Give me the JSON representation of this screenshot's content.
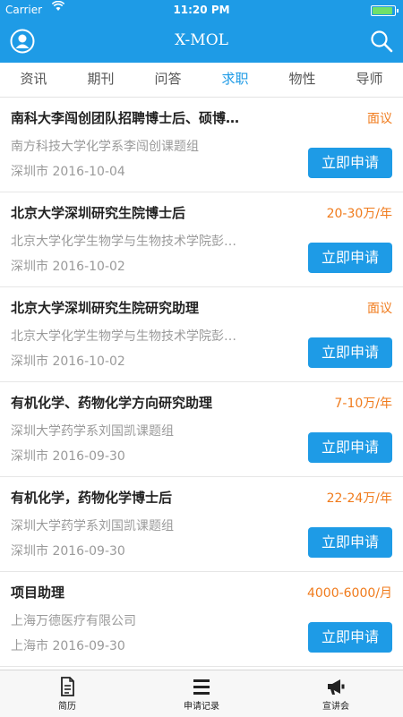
{
  "status_bar": {
    "carrier": "Carrier",
    "time": "11:20 PM"
  },
  "nav": {
    "title": "X-MOL",
    "profile_icon": "person-circle-icon",
    "search_icon": "search-icon"
  },
  "tabs": [
    {
      "label": "资讯"
    },
    {
      "label": "期刊"
    },
    {
      "label": "问答"
    },
    {
      "label": "求职",
      "active": true
    },
    {
      "label": "物性"
    },
    {
      "label": "导师"
    }
  ],
  "apply_label": "立即申请",
  "jobs": [
    {
      "title": "南科大李闯创团队招聘博士后、硕博…",
      "salary": "面议",
      "org": "南方科技大学化学系李闯创课题组",
      "meta": "深圳市 2016-10-04"
    },
    {
      "title": "北京大学深圳研究生院博士后",
      "salary": "20-30万/年",
      "org": "北京大学化学生物学与生物技术学院彭…",
      "meta": "深圳市 2016-10-02"
    },
    {
      "title": "北京大学深圳研究生院研究助理",
      "salary": "面议",
      "org": "北京大学化学生物学与生物技术学院彭…",
      "meta": "深圳市 2016-10-02"
    },
    {
      "title": "有机化学、药物化学方向研究助理",
      "salary": "7-10万/年",
      "org": "深圳大学药学系刘国凯课题组",
      "meta": "深圳市 2016-09-30"
    },
    {
      "title": "有机化学，药物化学博士后",
      "salary": "22-24万/年",
      "org": "深圳大学药学系刘国凯课题组",
      "meta": "深圳市 2016-09-30"
    },
    {
      "title": "项目助理",
      "salary": "4000-6000/月",
      "org": "上海万德医疗有限公司",
      "meta": "上海市 2016-09-30"
    }
  ],
  "bottom_bar": {
    "items": [
      {
        "label": "简历",
        "icon": "document-icon"
      },
      {
        "label": "申请记录",
        "icon": "list-icon"
      },
      {
        "label": "宣讲会",
        "icon": "megaphone-icon"
      }
    ]
  },
  "colors": {
    "primary": "#1e9be6",
    "salary": "#f07b1c",
    "muted": "#9a9a9a"
  }
}
